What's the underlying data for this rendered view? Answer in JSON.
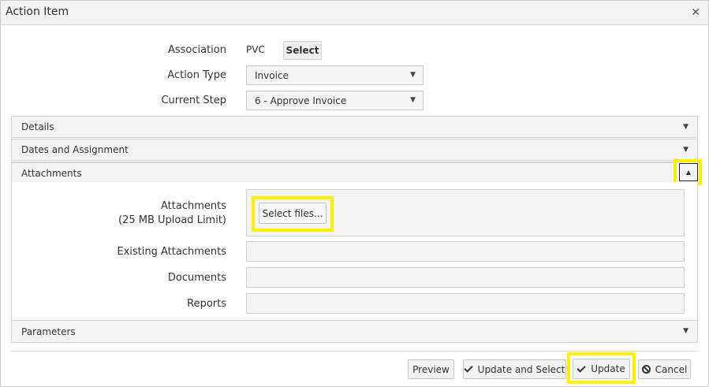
{
  "dialog": {
    "title": "Action Item"
  },
  "form": {
    "association_label": "Association",
    "association_value": "PVC",
    "association_select_label": "Select",
    "action_type_label": "Action Type",
    "action_type_value": "Invoice",
    "current_step_label": "Current Step",
    "current_step_value": "6 - Approve Invoice"
  },
  "panels": {
    "details": "Details",
    "dates": "Dates and Assignment",
    "attachments": "Attachments",
    "parameters": "Parameters"
  },
  "attachments": {
    "label_line1": "Attachments",
    "label_line2": "(25 MB Upload Limit)",
    "select_files": "Select files...",
    "existing_label": "Existing Attachments",
    "documents_label": "Documents",
    "reports_label": "Reports"
  },
  "footer": {
    "preview": "Preview",
    "update_and_select": "Update and Select",
    "update": "Update",
    "cancel": "Cancel"
  },
  "icons": {
    "close": "close-icon",
    "caret_down": "caret-down-icon",
    "caret_up": "caret-up-icon",
    "check": "check-icon",
    "cancel": "cancel-icon"
  },
  "colors": {
    "highlight": "#ffef00"
  }
}
